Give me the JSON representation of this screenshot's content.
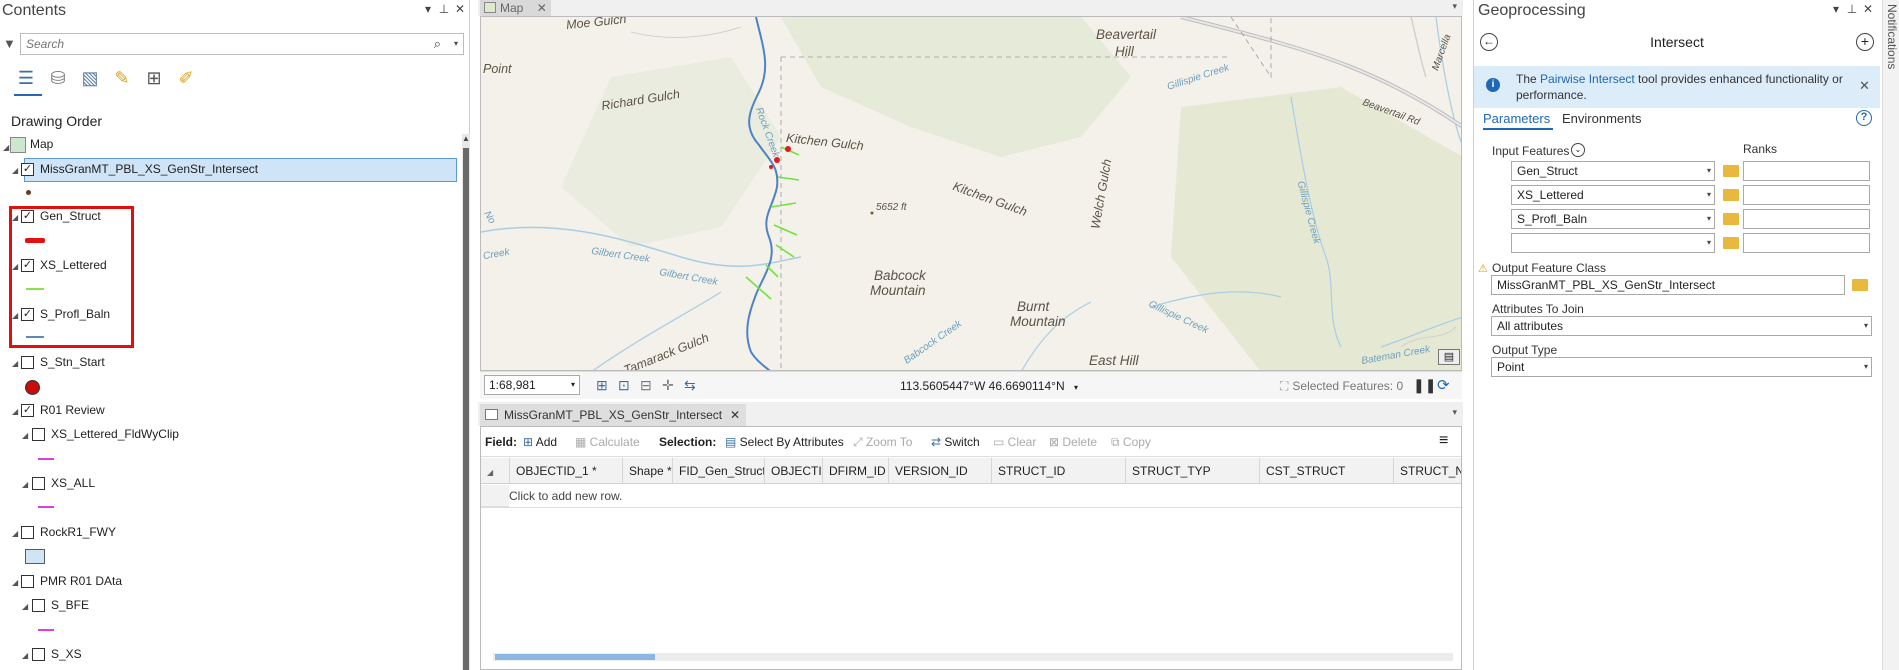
{
  "contents": {
    "title": "Contents",
    "search_placeholder": "Search",
    "drawing_order": "Drawing Order",
    "layers": [
      {
        "label": "Map",
        "checked": null
      },
      {
        "label": "MissGranMT_PBL_XS_GenStr_Intersect",
        "checked": true
      },
      {
        "label": "Gen_Struct",
        "checked": true
      },
      {
        "label": "XS_Lettered",
        "checked": true
      },
      {
        "label": "S_Profl_Baln",
        "checked": true
      },
      {
        "label": "S_Stn_Start",
        "checked": false
      },
      {
        "label": "R01 Review",
        "checked": true
      },
      {
        "label": "XS_Lettered_FldWyClip",
        "checked": false
      },
      {
        "label": "XS_ALL",
        "checked": false
      },
      {
        "label": "RockR1_FWY",
        "checked": false
      },
      {
        "label": "PMR R01 DAta",
        "checked": false
      },
      {
        "label": "S_BFE",
        "checked": false
      },
      {
        "label": "S_XS",
        "checked": false
      }
    ]
  },
  "map": {
    "tab_label": "Map",
    "labels": {
      "moe_gulch": "Moe Gulch",
      "point": "Point",
      "richard_gulch": "Richard Gulch",
      "kitchen_gulch_1": "Kitchen Gulch",
      "kitchen_gulch_2": "Kitchen Gulch",
      "beavertail_hill_1": "Beavertail",
      "beavertail_hill_2": "Hill",
      "babcock_mountain_1": "Babcock",
      "babcock_mountain_2": "Mountain",
      "burnt_mountain_1": "Burnt",
      "burnt_mountain_2": "Mountain",
      "east_hill": "East Hill",
      "tamarack_gulch": "Tamarack Gulch",
      "welch_gulch": "Welch Gulch",
      "elevation": "5652 ft"
    },
    "water_labels": {
      "gilbert_creek_1": "Gilbert Creek",
      "gilbert_creek_2": "Gilbert Creek",
      "creek": "Creek",
      "gillispie_creek_1": "Gillispie Creek",
      "gillispie_creek_2": "Gillispie Creek",
      "babcock_creek": "Babcock Creek",
      "bateman_creek": "Bateman Creek",
      "no": "No",
      "rock_creek": "Rock Creek"
    },
    "road_labels": {
      "beavertail_rd": "Beavertail Rd",
      "marcella": "Marcella"
    },
    "scale": "1:68,981",
    "coords": "113.5605447°W 46.6690114°N",
    "selected_features": "Selected Features: 0"
  },
  "attribute_table": {
    "tab_label": "MissGranMT_PBL_XS_GenStr_Intersect",
    "field_label": "Field:",
    "add": "Add",
    "calculate": "Calculate",
    "selection_label": "Selection:",
    "select_by_attributes": "Select By Attributes",
    "zoom_to": "Zoom To",
    "switch": "Switch",
    "clear": "Clear",
    "delete": "Delete",
    "copy": "Copy",
    "columns": [
      "OBJECTID_1 *",
      "Shape *",
      "FID_Gen_Struct",
      "OBJECTID",
      "DFIRM_ID",
      "VERSION_ID",
      "STRUCT_ID",
      "STRUCT_TYP",
      "CST_STRUCT",
      "STRUCT_NM"
    ],
    "new_row_hint": "Click to add new row."
  },
  "geoprocessing": {
    "title": "Geoprocessing",
    "tool_name": "Intersect",
    "info_pre": "The ",
    "info_link": "Pairwise Intersect",
    "info_post": " tool provides enhanced functionality or performance.",
    "tab_parameters": "Parameters",
    "tab_environments": "Environments",
    "input_features_label": "Input Features",
    "ranks_label": "Ranks",
    "inputs": [
      "Gen_Struct",
      "XS_Lettered",
      "S_Profl_Baln",
      ""
    ],
    "output_label": "Output Feature Class",
    "output_value": "MissGranMT_PBL_XS_GenStr_Intersect",
    "attributes_label": "Attributes To Join",
    "attributes_value": "All attributes",
    "output_type_label": "Output Type",
    "output_type_value": "Point"
  },
  "notifications": "Notifications"
}
